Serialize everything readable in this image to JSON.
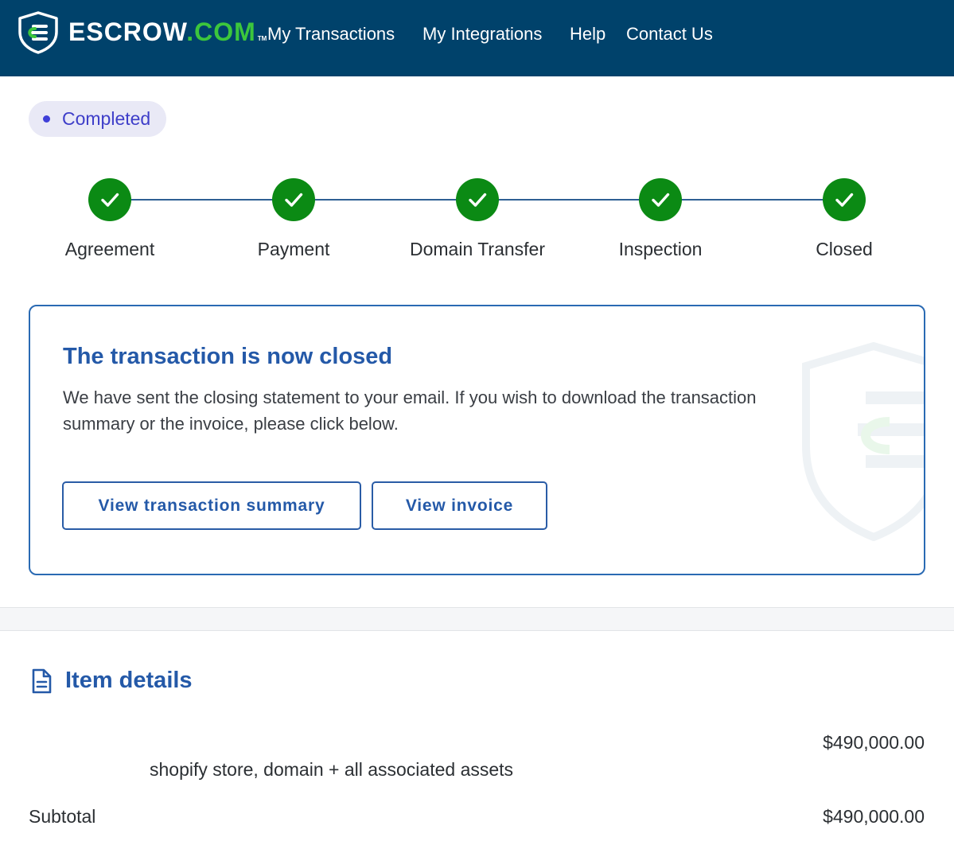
{
  "header": {
    "brand_main": "ESCROW",
    "brand_dot_com": ".COM",
    "brand_tm": "TM",
    "nav": [
      {
        "label": "My Transactions"
      },
      {
        "label": "My Integrations"
      },
      {
        "label": "Help"
      },
      {
        "label": "Contact Us"
      }
    ]
  },
  "status": {
    "label": "Completed",
    "color": "#3e3ec9"
  },
  "steps": [
    {
      "label": "Agreement",
      "completed": true
    },
    {
      "label": "Payment",
      "completed": true
    },
    {
      "label": "Domain Transfer",
      "completed": true
    },
    {
      "label": "Inspection",
      "completed": true
    },
    {
      "label": "Closed",
      "completed": true
    }
  ],
  "closed_card": {
    "title": "The transaction is now closed",
    "body": "We have sent the closing statement to your email. If you wish to download the transaction summary or the invoice, please click below.",
    "summary_button": "View transaction summary",
    "invoice_button": "View invoice"
  },
  "item_details": {
    "title": "Item details",
    "item": {
      "description": "shopify store, domain + all associated assets",
      "price": "$490,000.00"
    },
    "subtotal_label": "Subtotal",
    "subtotal_value": "$490,000.00"
  },
  "colors": {
    "header_bg": "#00426b",
    "brand_accent": "#3cc63c",
    "step_complete": "#0b8a14",
    "primary_blue": "#2459a8"
  },
  "icons": {
    "logo": "escrow-shield-icon",
    "step": "checkmark-icon",
    "item_details": "document-icon"
  }
}
